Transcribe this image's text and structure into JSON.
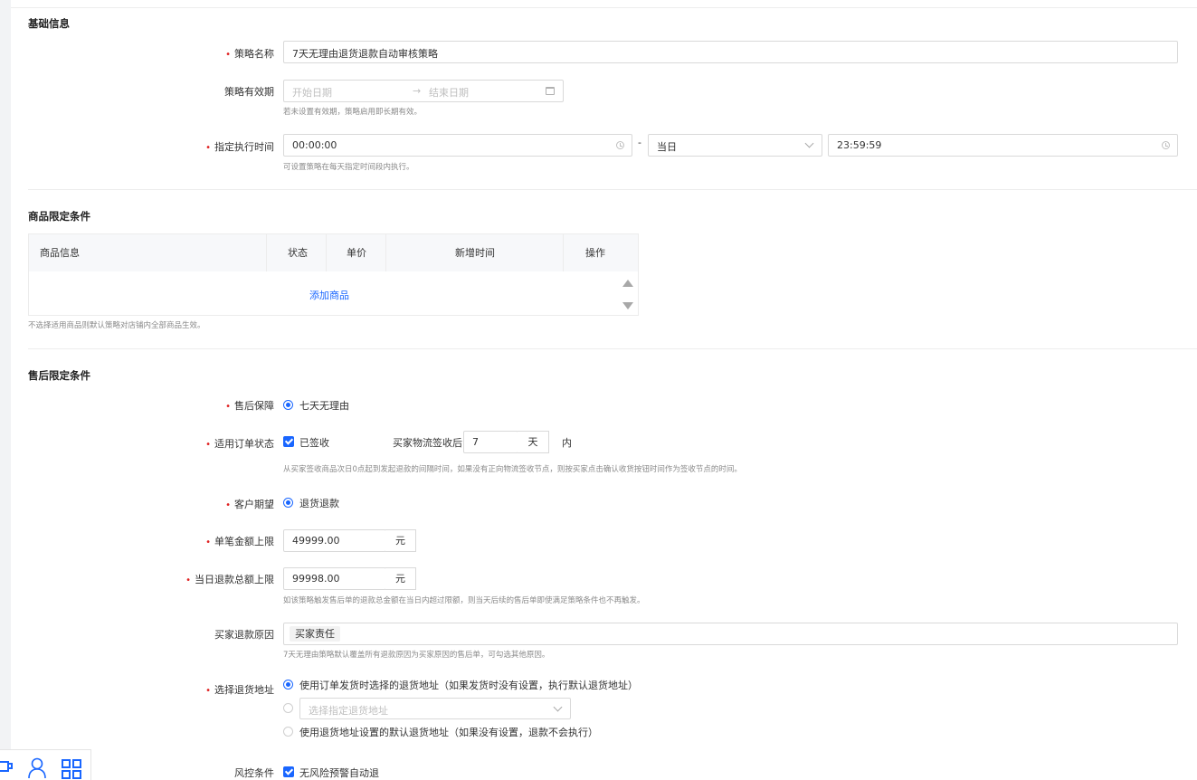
{
  "basic": {
    "section_title": "基础信息",
    "strategy_name_label": "策略名称",
    "strategy_name_value": "7天无理由退货退款自动审核策略",
    "validity_label": "策略有效期",
    "start_date_placeholder": "开始日期",
    "range_arrow": "→",
    "end_date_placeholder": "结束日期",
    "validity_help": "若未设置有效期，策略启用即长期有效。",
    "exec_time_label": "指定执行时间",
    "start_time_value": "00:00:00",
    "range_dash": "-",
    "day_select_value": "当日",
    "end_time_value": "23:59:59",
    "exec_time_help": "可设置策略在每天指定时间段内执行。"
  },
  "goods": {
    "section_title": "商品限定条件",
    "columns": [
      "商品信息",
      "状态",
      "单价",
      "新增时间",
      "操作"
    ],
    "add_goods_link": "添加商品",
    "help": "不选择适用商品则默认策略对店铺内全部商品生效。"
  },
  "aftersale": {
    "section_title": "售后限定条件",
    "guarantee_label": "售后保障",
    "guarantee_option": "七天无理由",
    "order_status_label": "适用订单状态",
    "signed_option": "已签收",
    "logistics_label": "买家物流签收后",
    "days_value": "7",
    "days_unit": "天",
    "within": "内",
    "order_status_help": "从买家签收商品次日0点起到发起退款的间隔时间，如果没有正向物流签收节点，则按买家点击确认收货按钮时间作为签收节点的时间。",
    "expectation_label": "客户期望",
    "expectation_option": "退货退款",
    "single_limit_label": "单笔金额上限",
    "single_limit_value": "49999.00",
    "single_limit_unit": "元",
    "daily_limit_label": "当日退款总额上限",
    "daily_limit_value": "99998.00",
    "daily_limit_unit": "元",
    "daily_limit_help": "如该策略触发售后单的退款总金额在当日内超过限额，则当天后续的售后单即使满足策略条件也不再触发。",
    "reason_label": "买家退款原因",
    "reason_tag": "买家责任",
    "reason_help": "7天无理由策略默认覆盖所有退款原因为买家原因的售后单，可勾选其他原因。",
    "address_label": "选择退货地址",
    "address_option1": "使用订单发货时选择的退货地址（如果发货时没有设置，执行默认退货地址）",
    "address_select_placeholder": "选择指定退货地址",
    "address_option3": "使用退货地址设置的默认退货地址（如果没有设置，退款不会执行）",
    "risk_label": "风控条件",
    "risk_option": "无风险预警自动退"
  },
  "colors": {
    "primary": "#1966ff",
    "required": "#e02020"
  },
  "icons": [
    "clock-icon",
    "calendar-icon",
    "chevron-down-icon",
    "scroll-up-icon",
    "scroll-down-icon",
    "user-icon",
    "grid-icon",
    "cup-icon"
  ]
}
